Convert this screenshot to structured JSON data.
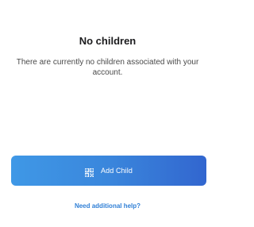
{
  "empty_state": {
    "title": "No children",
    "message": "There are currently no children associated with your account."
  },
  "actions": {
    "add_child_label": "Add Child",
    "add_child_icon": "qr-code-icon",
    "help_link_label": "Need additional help?"
  },
  "colors": {
    "button_gradient_start": "#3f98e6",
    "button_gradient_end": "#3266cf",
    "link": "#2f7fd6",
    "title": "#1c1c1e",
    "body_text": "#4a4a4a"
  }
}
